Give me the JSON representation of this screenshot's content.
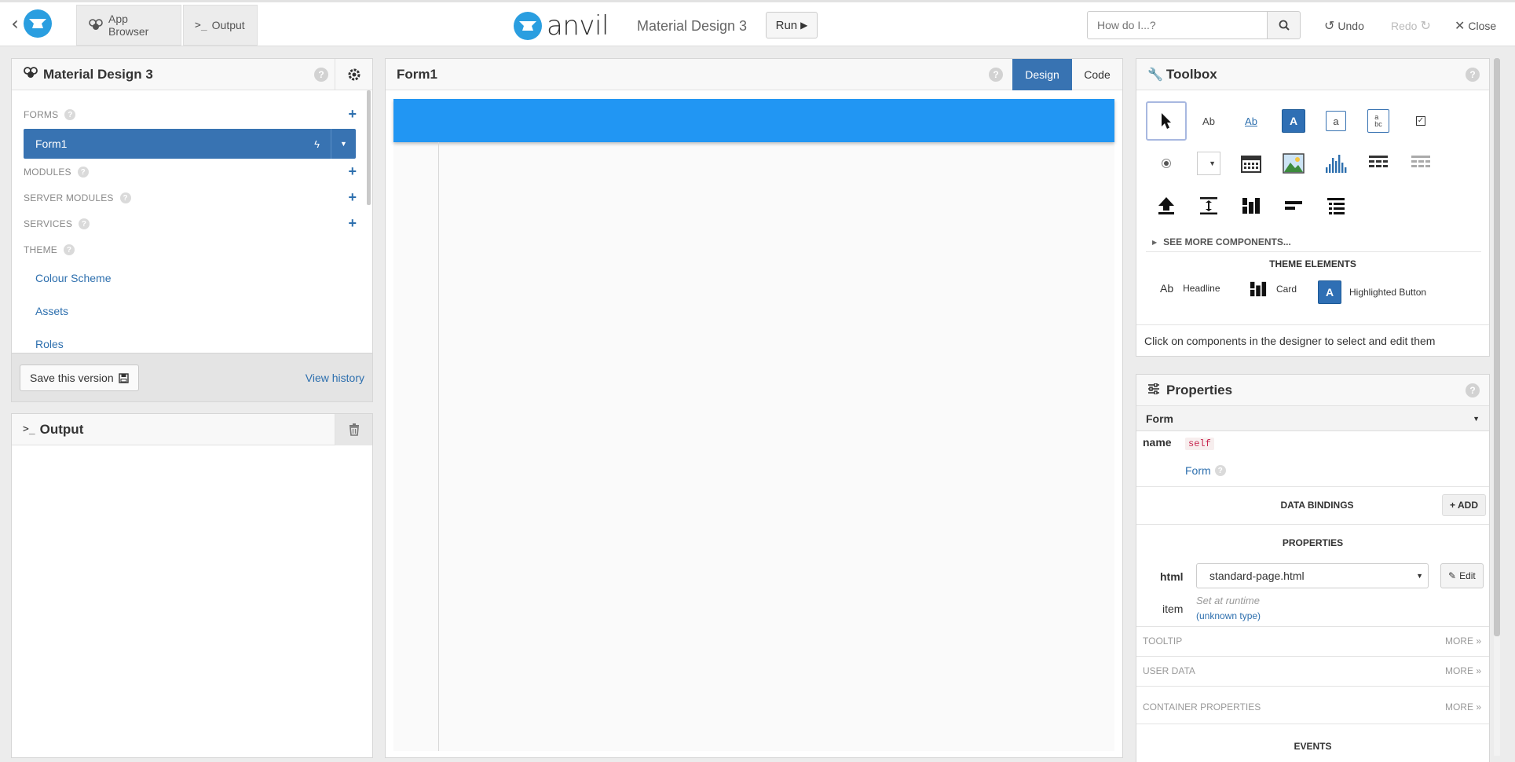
{
  "topbar": {
    "app_browser_label": "App Browser",
    "output_label": "Output",
    "logo_text": "anvil",
    "app_title": "Material Design 3",
    "run_label": "Run",
    "search_placeholder": "How do I...?",
    "undo_label": "Undo",
    "redo_label": "Redo",
    "close_label": "Close"
  },
  "app_browser": {
    "title": "Material Design 3",
    "sections": {
      "forms": "FORMS",
      "modules": "MODULES",
      "server_modules": "SERVER MODULES",
      "services": "SERVICES",
      "theme": "THEME"
    },
    "form_item": "Form1",
    "theme_items": [
      "Colour Scheme",
      "Assets",
      "Roles"
    ],
    "save_label": "Save this version",
    "view_history_label": "View history"
  },
  "output_panel": {
    "title": "Output"
  },
  "designer": {
    "title": "Form1",
    "tab_design": "Design",
    "tab_code": "Code",
    "header_color": "#2196f3"
  },
  "toolbox": {
    "title": "Toolbox",
    "tools_row1": [
      "Ab",
      "Ab",
      "A",
      "a"
    ],
    "see_more": "SEE MORE COMPONENTS...",
    "theme_elements_title": "THEME ELEMENTS",
    "theme_elements": [
      "Headline",
      "Card",
      "Highlighted Button"
    ],
    "theme_abbrev": "Ab",
    "theme_a": "A",
    "hint": "Click on components in the designer to select and edit them"
  },
  "properties": {
    "title": "Properties",
    "selected": "Form",
    "name_label": "name",
    "name_value": "self",
    "type_link": "Form",
    "data_bindings_label": "DATA BINDINGS",
    "add_label": "ADD",
    "properties_label": "PROPERTIES",
    "html_label": "html",
    "html_value": "standard-page.html",
    "edit_label": "Edit",
    "item_label": "item",
    "item_placeholder": "Set at runtime",
    "item_type": "(unknown type)",
    "tooltip_label": "TOOLTIP",
    "user_data_label": "USER DATA",
    "container_props_label": "CONTAINER PROPERTIES",
    "more_label": "MORE",
    "events_label": "EVENTS"
  },
  "colors": {
    "accent": "#3873b2",
    "logo_blue": "#2a9ee0"
  }
}
